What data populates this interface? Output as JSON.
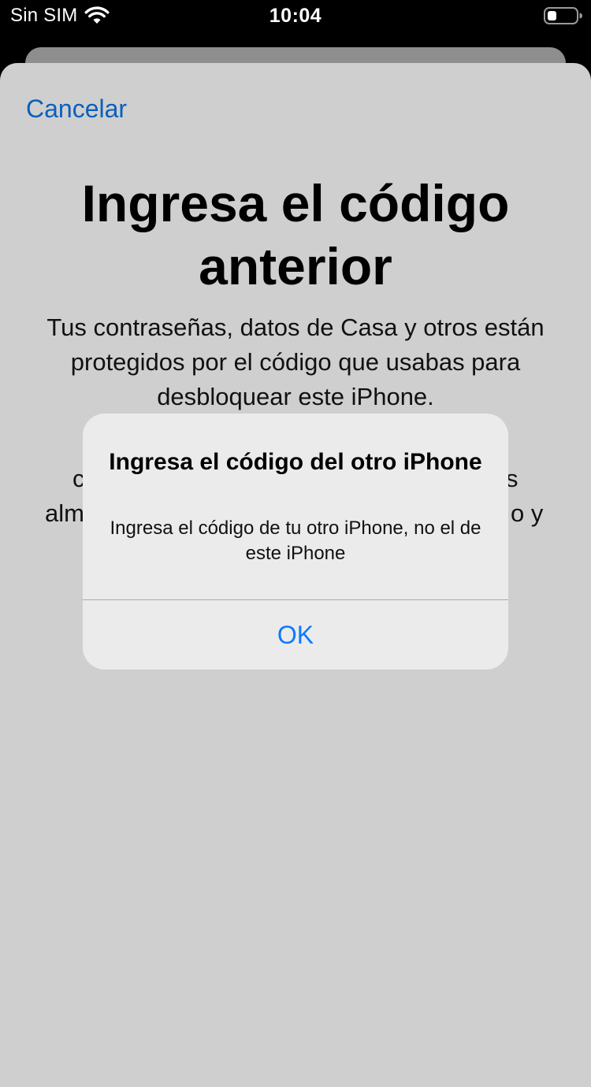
{
  "status_bar": {
    "carrier": "Sin SIM",
    "time": "10:04",
    "wifi_icon": "wifi-icon",
    "battery_icon": "battery-low-icon"
  },
  "sheet": {
    "cancel_label": "Cancelar",
    "title": "Ingresa el código anterior",
    "description": "Tus contraseñas, datos de Casa y otros están protegidos por el código que usabas para desbloquear este iPhone.",
    "partial_fragments": [
      "c",
      "s",
      "alm",
      "o y"
    ]
  },
  "alert": {
    "title": "Ingresa el código del otro iPhone",
    "message": "Ingresa el código de tu otro iPhone, no el de este iPhone",
    "ok_label": "OK"
  },
  "colors": {
    "accent": "#0a7aff",
    "link_dimmed": "#0a5fbd",
    "sheet_background_dimmed": "#cfcfcf",
    "alert_background": "#ebebeb"
  }
}
